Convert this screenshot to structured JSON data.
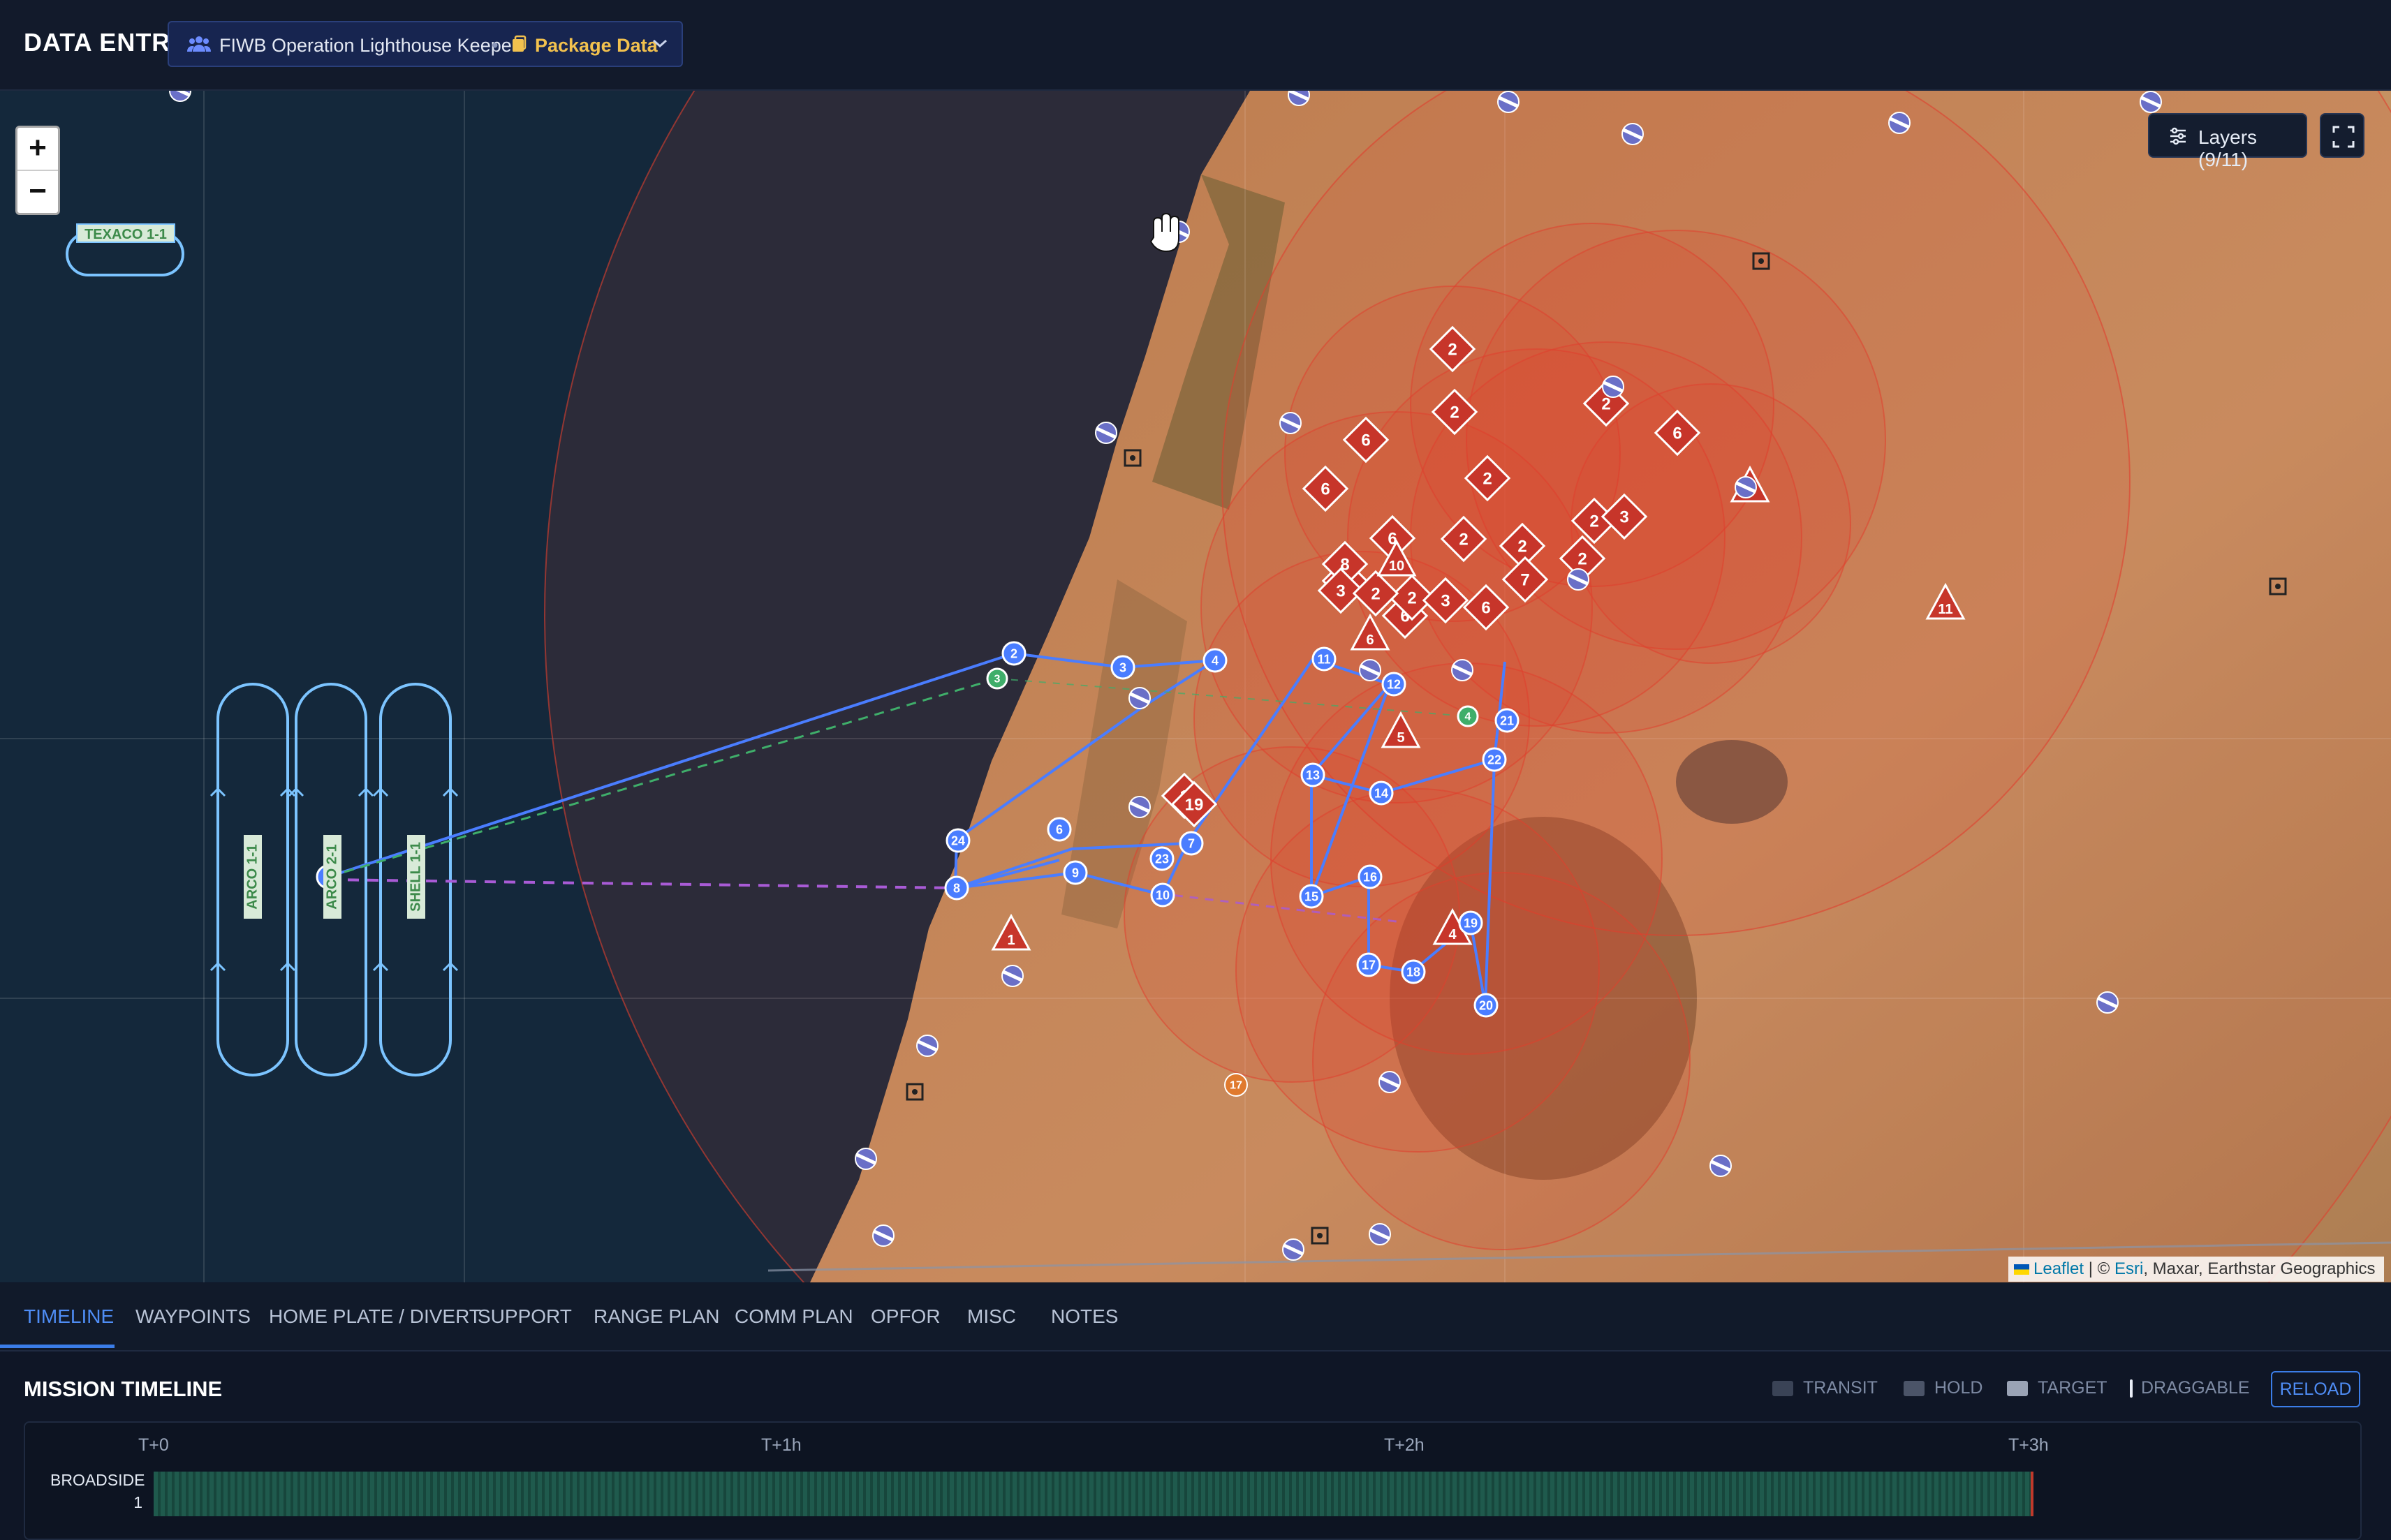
{
  "header": {
    "app_title": "DATA ENTRY",
    "operation_name": "FIWB Operation Lighthouse Keeper",
    "separator": "•",
    "package_label": "Package Data"
  },
  "map": {
    "zoom_in": "+",
    "zoom_out": "−",
    "layers_label": "Layers (9/11)",
    "tanker_tracks": [
      "TEXACO 1-1",
      "ARCO 1-1",
      "ARCO 2-1",
      "SHELL 1-1"
    ],
    "route_waypoints": [
      "1",
      "2",
      "3",
      "4",
      "6",
      "7",
      "8",
      "9",
      "10",
      "11",
      "12",
      "13",
      "14",
      "15",
      "16",
      "17",
      "18",
      "19",
      "20",
      "21",
      "22",
      "23",
      "24"
    ],
    "green_points": [
      "3",
      "4"
    ],
    "threat_diamonds": [
      "2",
      "6",
      "2",
      "6",
      "2",
      "2",
      "6",
      "2",
      "2",
      "6",
      "3",
      "6",
      "8",
      "3",
      "2",
      "7",
      "6",
      "2",
      "3",
      "2",
      "2",
      "3",
      "1",
      "19"
    ],
    "threat_triangles": [
      "9",
      "10",
      "6",
      "5",
      "11",
      "1",
      "4"
    ],
    "orange_point": "17",
    "attribution": {
      "leaflet": "Leaflet",
      "divider": "| ©",
      "esri": "Esri",
      "rest": ", Maxar, Earthstar Geographics"
    },
    "colors": {
      "route": "#4a7dff",
      "threat": "#d93a2b",
      "tanker_track": "#7cc4ff",
      "green": "#3fae6a"
    }
  },
  "tabs": [
    "TIMELINE",
    "WAYPOINTS",
    "HOME PLATE / DIVERT",
    "SUPPORT",
    "RANGE PLAN",
    "COMM PLAN",
    "OPFOR",
    "MISC",
    "NOTES"
  ],
  "active_tab": "TIMELINE",
  "timeline": {
    "title": "MISSION TIMELINE",
    "legend": [
      "TRANSIT",
      "HOLD",
      "TARGET",
      "DRAGGABLE"
    ],
    "reload_label": "RELOAD",
    "ticks": [
      "T+0",
      "T+1h",
      "T+2h",
      "T+3h"
    ],
    "rows": [
      {
        "label_line1": "BROADSIDE",
        "label_line2": "1"
      }
    ]
  }
}
